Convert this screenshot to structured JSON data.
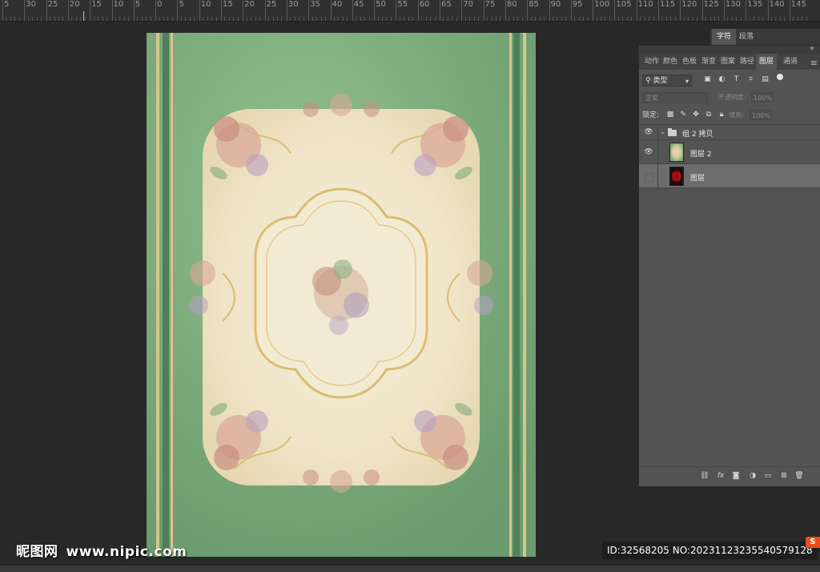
{
  "ruler": {
    "labels": [
      "5",
      "30",
      "25",
      "20",
      "15",
      "10",
      "5",
      "0",
      "5",
      "10",
      "15",
      "20",
      "25",
      "30",
      "35",
      "40",
      "45",
      "50",
      "55",
      "60",
      "65",
      "70",
      "75",
      "80",
      "85",
      "90",
      "95",
      "100",
      "105",
      "110",
      "115",
      "120",
      "125",
      "130",
      "135",
      "140",
      "145"
    ]
  },
  "panel_tabs_top": [
    "字符",
    "段落"
  ],
  "layers_panel": {
    "tabs": [
      "动作",
      "颜色",
      "色板",
      "渐变",
      "图案",
      "路径",
      "图层",
      "通道"
    ],
    "active_tab": "图层",
    "filter": {
      "label": "类型"
    },
    "blend_mode": "正常",
    "opacity_label": "不透明度:",
    "opacity_value": "100%",
    "lock_label": "锁定:",
    "fill_label": "填充:",
    "fill_value": "100%",
    "layers": [
      {
        "name": "组 2 拷贝",
        "type": "group",
        "visible": true
      },
      {
        "name": "图层 2",
        "type": "layer",
        "visible": true
      },
      {
        "name": "图层",
        "type": "layer",
        "visible": false,
        "selected": true
      }
    ]
  },
  "watermarks": {
    "left_brand": "昵图网",
    "left_url": "www.nipic.com",
    "right_id": "ID:32568205 NO:20231123235540579128"
  },
  "colors": {
    "workspace": "#282828",
    "panel": "#535353",
    "selected_row": "#6c6c6c",
    "carpet_green": "#7aa97b",
    "carpet_cream": "#efe6cc",
    "badge": "#e84e1b"
  }
}
